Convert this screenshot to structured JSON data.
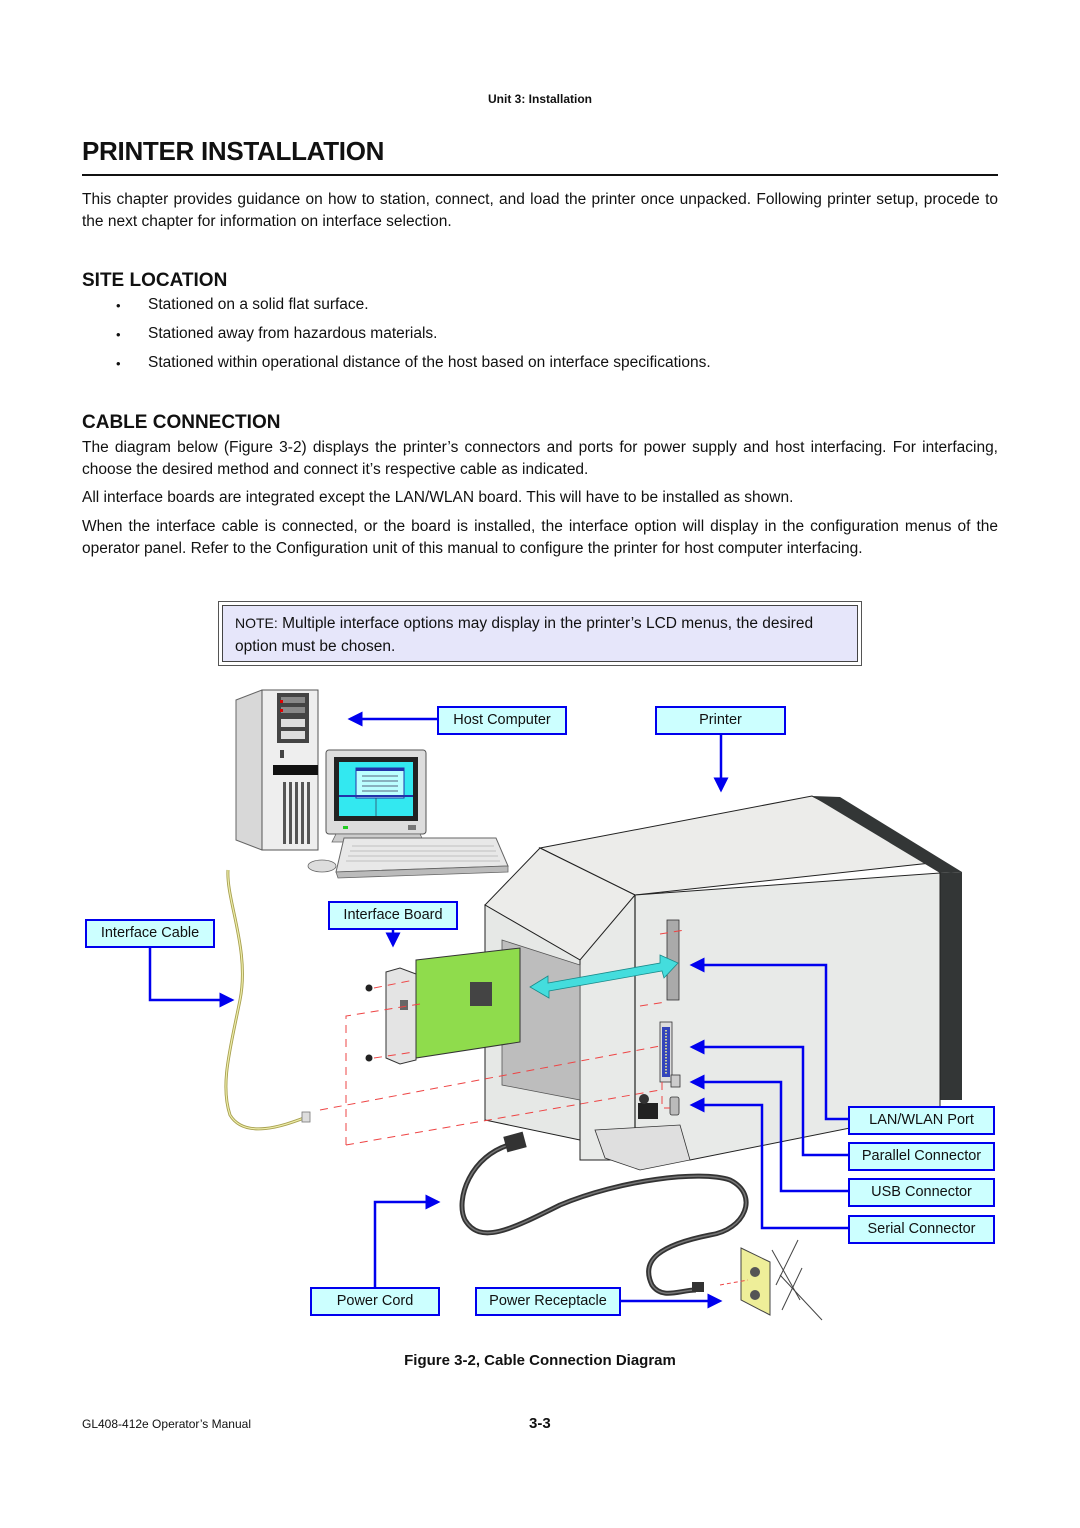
{
  "header": {
    "running_title": "Unit 3:  Installation"
  },
  "page_title": "PRINTER INSTALLATION",
  "intro": "This chapter provides guidance on how to station, connect, and load the printer once unpacked.  Following printer setup, procede to the next chapter for information on interface selection.",
  "site_location": {
    "heading": "SITE LOCATION",
    "bullets": [
      "Stationed on a solid flat surface.",
      "Stationed away from hazardous materials.",
      "Stationed within operational distance of the host based on interface specifications."
    ]
  },
  "cable_connection": {
    "heading": "CABLE CONNECTION",
    "paragraphs": [
      "The diagram below (Figure 3-2) displays the printer’s connectors and ports for power supply and host interfacing. For interfacing, choose the desired method and connect it’s respective cable as indicated.",
      "All interface boards are integrated except the LAN/WLAN board. This will have to be installed as shown.",
      "When the interface cable is connected, or the board is installed, the interface option will display in the configuration menus of the operator panel. Refer to the Configuration unit of this manual to configure the printer for host computer interfacing."
    ]
  },
  "note": {
    "label": "NOTE:",
    "text": " Multiple interface options may display in the printer’s LCD menus, the desired option must be chosen."
  },
  "diagram": {
    "callouts": {
      "host_computer": "Host Computer",
      "printer": "Printer",
      "interface_board": "Interface Board",
      "interface_cable": "Interface Cable",
      "lan_wlan_port": "LAN/WLAN Port",
      "parallel_connector": "Parallel Connector",
      "usb_connector": "USB Connector",
      "serial_connector": "Serial Connector",
      "power_cord": "Power Cord",
      "power_receptacle": "Power Receptacle"
    },
    "colors": {
      "callout_fill": "#ccffff",
      "callout_border": "#0000ee",
      "leader_line": "#0000ee",
      "board_green": "#8fdc4c",
      "double_arrow": "#44dddd",
      "printer_body": "#e8eae8",
      "printer_dark_panel": "#333636",
      "dashed_guide": "#ee4444",
      "receptacle_plate": "#eeee99"
    }
  },
  "caption": "Figure 3-2, Cable Connection Diagram",
  "footer": {
    "manual_name": "GL408-412e Operator’s Manual",
    "page_number": "3-3"
  }
}
